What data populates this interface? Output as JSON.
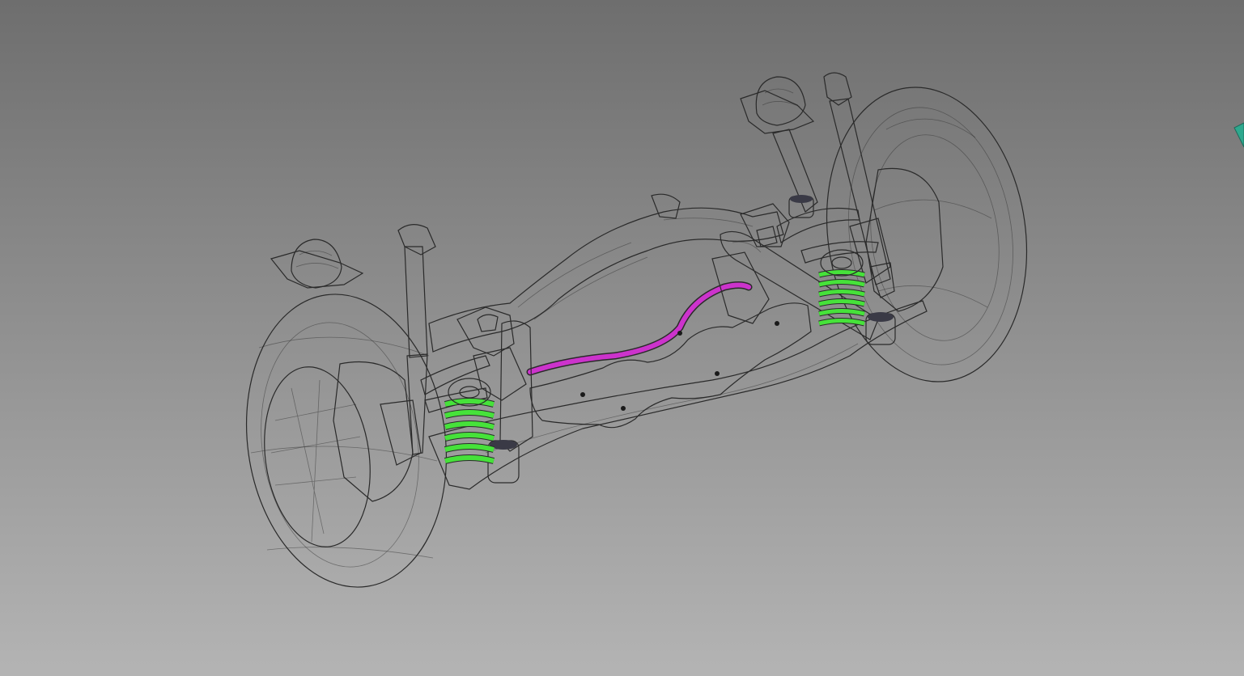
{
  "viewer": {
    "background_top": "#6e6e6e",
    "background_bottom": "#b4b4b4"
  },
  "parts": {
    "tire": {
      "icon": "tire-wireframe",
      "color": "#9a9a9a"
    },
    "knuckle": {
      "icon": "knuckle-hub",
      "color": "#4cd23c"
    },
    "shock_absorber": {
      "icon": "damper-strut",
      "color": "#d67a14"
    },
    "strut_top_mount": {
      "icon": "top-mount",
      "color": "#f2e84a"
    },
    "mount_bracket": {
      "icon": "bracket-plate",
      "color": "#e8877a"
    },
    "crossmember": {
      "icon": "cross-beam",
      "color": "#2a86d8"
    },
    "subframe": {
      "icon": "subframe",
      "color": "#24a21e"
    },
    "lower_arm": {
      "icon": "lower-arm",
      "color": "#e6e032"
    },
    "coil_spring": {
      "icon": "coil-spring",
      "color": "#46e23a"
    },
    "spring_seat": {
      "icon": "spring-seat",
      "color": "#8a86d8"
    },
    "trailing_link": {
      "icon": "link-arm",
      "color": "#a8a8b4"
    },
    "upper_link": {
      "icon": "upper-link",
      "color": "#e0e0e0"
    },
    "stabilizer_bar": {
      "icon": "anti-roll-bar",
      "color": "#cc33cc"
    },
    "bracket": {
      "icon": "bracket",
      "color": "#3cc8b4"
    },
    "bushing": {
      "icon": "rubber-bushing",
      "color": "#2a2a34"
    },
    "brace": {
      "icon": "brace",
      "color": "#9b4a36"
    }
  },
  "compass_accent": "#2ea88e"
}
